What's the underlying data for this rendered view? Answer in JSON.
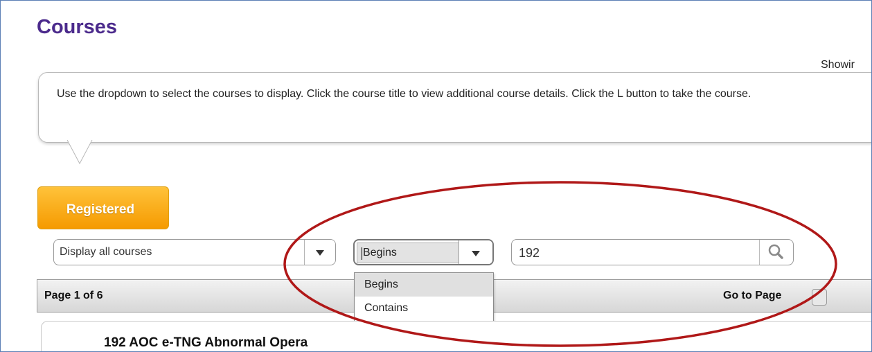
{
  "page": {
    "title": "Courses",
    "showing_label": "Showir"
  },
  "help_bubble": {
    "text": "Use the dropdown to select the courses to display. Click the course title to view additional course details. Click the L button to take the course."
  },
  "tabs": {
    "registered_label": "Registered"
  },
  "filters": {
    "display_value": "Display all courses",
    "match_value": "Begins",
    "match_options": [
      "Begins",
      "Contains"
    ],
    "search_value": "192"
  },
  "pager": {
    "page_label": "Page 1 of 6",
    "goto_label": "Go to Page"
  },
  "courses": [
    {
      "title": "192 AOC e-TNG Abnormal Opera"
    }
  ],
  "colors": {
    "title": "#4b2a8c",
    "accent_orange": "#f59a00",
    "annotation_oval": "#b01818",
    "frame_border": "#5b7fb5"
  },
  "icons": {
    "dropdown_arrow": "chevron-down-icon",
    "search": "search-icon"
  }
}
